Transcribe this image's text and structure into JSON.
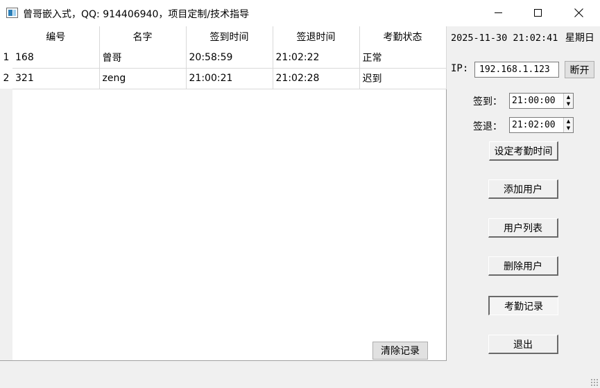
{
  "window": {
    "title": "曾哥嵌入式，QQ: 914406940，项目定制/技术指导"
  },
  "table": {
    "columns": [
      "编号",
      "名字",
      "签到时间",
      "签退时间",
      "考勤状态"
    ],
    "rows": [
      {
        "num": "1",
        "cells": [
          "168",
          "曾哥",
          "20:58:59",
          "21:02:22",
          "正常"
        ]
      },
      {
        "num": "2",
        "cells": [
          "321",
          "zeng",
          "21:00:21",
          "21:02:28",
          "迟到"
        ]
      }
    ],
    "clear_label": "清除记录"
  },
  "panel": {
    "datetime": "2025-11-30 21:02:41",
    "weekday": "星期日",
    "ip_label": "IP:",
    "ip_value": "192.168.1.123",
    "disconnect_label": "断开",
    "checkin_label": "签到：",
    "checkin_time": "21:00:00",
    "checkout_label": "签退：",
    "checkout_time": "21:02:00",
    "set_time_label": "设定考勤时间",
    "add_user_label": "添加用户",
    "user_list_label": "用户列表",
    "delete_user_label": "删除用户",
    "attendance_label": "考勤记录",
    "exit_label": "退出"
  }
}
